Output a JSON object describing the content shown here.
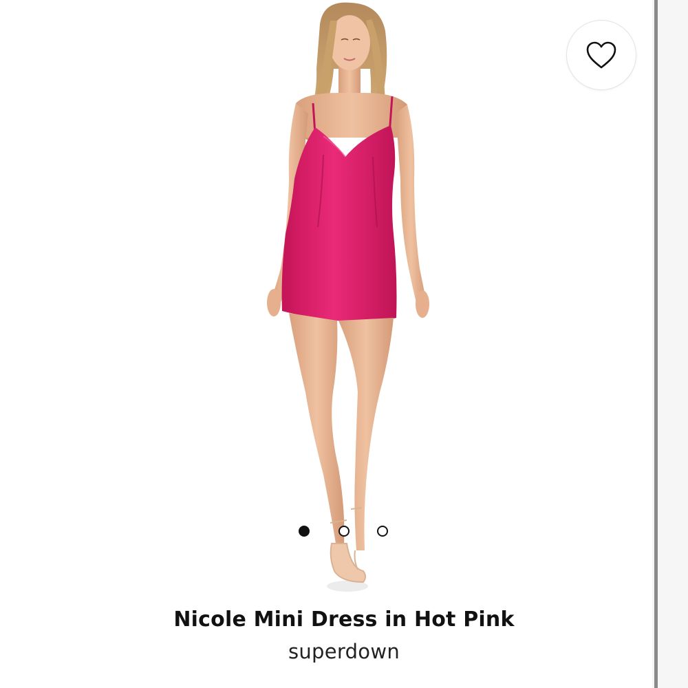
{
  "product": {
    "title": "Nicole Mini Dress in Hot Pink",
    "brand": "superdown",
    "dress_color": "#e0226e"
  },
  "favorite": {
    "icon": "heart-outline-icon"
  },
  "carousel": {
    "total": 3,
    "active_index": 0
  }
}
